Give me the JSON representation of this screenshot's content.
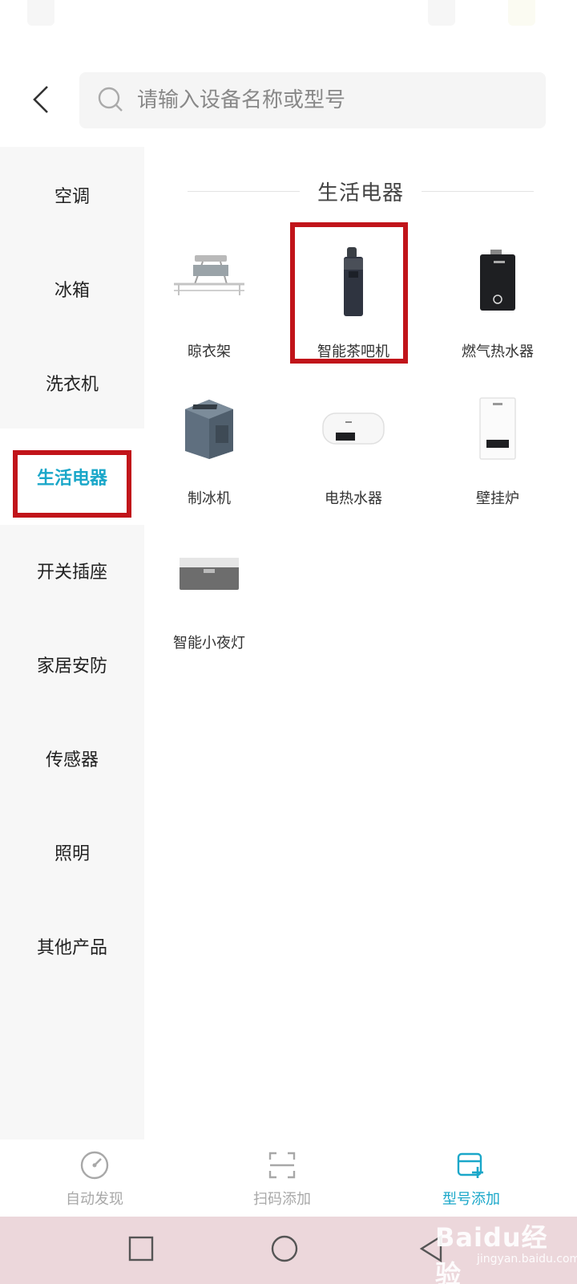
{
  "search": {
    "placeholder": "请输入设备名称或型号"
  },
  "sidebar": {
    "items": [
      {
        "label": "空调"
      },
      {
        "label": "冰箱"
      },
      {
        "label": "洗衣机"
      },
      {
        "label": "生活电器",
        "active": true
      },
      {
        "label": "开关插座"
      },
      {
        "label": "家居安防"
      },
      {
        "label": "传感器"
      },
      {
        "label": "照明"
      },
      {
        "label": "其他产品"
      }
    ]
  },
  "main": {
    "section_title": "生活电器",
    "products": [
      {
        "label": "晾衣架",
        "icon": "clothes-rack"
      },
      {
        "label": "智能茶吧机",
        "icon": "tea-bar-machine",
        "highlighted": true
      },
      {
        "label": "燃气热水器",
        "icon": "gas-water-heater"
      },
      {
        "label": "制冰机",
        "icon": "ice-maker"
      },
      {
        "label": "电热水器",
        "icon": "electric-water-heater"
      },
      {
        "label": "壁挂炉",
        "icon": "wall-boiler"
      },
      {
        "label": "智能小夜灯",
        "icon": "night-light"
      }
    ]
  },
  "tabbar": {
    "tabs": [
      {
        "label": "自动发现",
        "icon": "gauge-icon"
      },
      {
        "label": "扫码添加",
        "icon": "scan-icon"
      },
      {
        "label": "型号添加",
        "icon": "model-add-icon",
        "active": true
      }
    ]
  },
  "watermark": {
    "main": "Baidu经验",
    "sub": "jingyan.baidu.com"
  },
  "colors": {
    "accent": "#1aa7c9",
    "highlight_border": "#c1141a",
    "navbar_bg": "#ecd7db"
  }
}
